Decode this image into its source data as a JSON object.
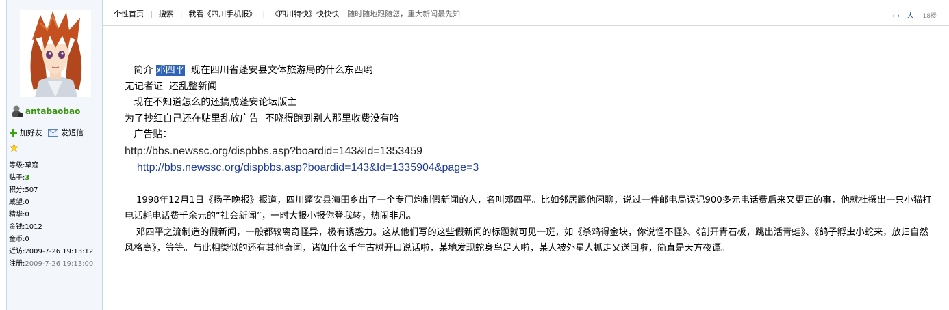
{
  "nav": {
    "items": [
      "个性首页",
      "搜索",
      "我看《四川手机报》",
      "《四川特快》快快快"
    ],
    "slogan": "随时随地跟随您，重大新闻最先知",
    "font_small": "小",
    "font_large": "大",
    "floor": "18楼"
  },
  "user": {
    "name": "antabaobao",
    "add_friend": "加好友",
    "send_message": "发短信",
    "stats": [
      {
        "label": "等级:",
        "value": "草寇"
      },
      {
        "label": "贴子:",
        "value": "3"
      },
      {
        "label": "积分:",
        "value": "507"
      },
      {
        "label": "威望:",
        "value": "0"
      },
      {
        "label": "精华:",
        "value": "0"
      },
      {
        "label": "金钱:",
        "value": "1012"
      },
      {
        "label": "金币:",
        "value": "0"
      },
      {
        "label": "近访:",
        "value": "2009-7-26 19:13:12"
      },
      {
        "label": "注册:",
        "value": "2009-7-26 19:13:00"
      }
    ]
  },
  "post": {
    "intro_prefix": "   简介 ",
    "intro_highlight": "邓四平",
    "intro_rest": "  现在四川省蓬安县文体旅游局的什么东西哟",
    "line2": "无记者证  还乱整新闻",
    "line3": "   现在不知道怎么的还搞成蓬安论坛版主",
    "line4": "为了抄红自己还在贴里乱放广告  不晓得跑到别人那里收费没有哈",
    "line5": "   广告贴：",
    "url1": "http://bbs.newssc.org/dispbbs.asp?boardid=143&Id=1353459",
    "url2": "http://bbs.newssc.org/dispbbs.asp?boardid=143&Id=1335904&page=3",
    "story1": "1998年12月1日《扬子晚报》报道，四川蓬安县海田乡出了一个专门炮制假新闻的人，名叫邓四平。比如邻居跟他闲聊，说过一件邮电局误记900多元电话费后来又更正的事，他就杜撰出一只小猫打电话耗电话费千余元的“社会新闻”，一时大报小报你登我转，热闹非凡。",
    "story2": "邓四平之流制造的假新闻，一般都较离奇怪异，极有诱惑力。这从他们写的这些假新闻的标题就可见一斑，如《杀鸡得金块，你说怪不怪》、《剖开青石板，跳出活青蛙》、《鸽子孵虫小蛇来，放归自然风格高》，等等。与此相类似的还有其他奇闻，诸如什么千年古树开口说话啦，某地发现蛇身鸟足人啦，某人被外星人抓走又送回啦，简直是天方夜谭。"
  },
  "colors": {
    "username": "#3b9310",
    "highlight_bg": "#2f63b6",
    "link": "#1f3c96",
    "sidebar_bg": "#f3f7fc"
  }
}
